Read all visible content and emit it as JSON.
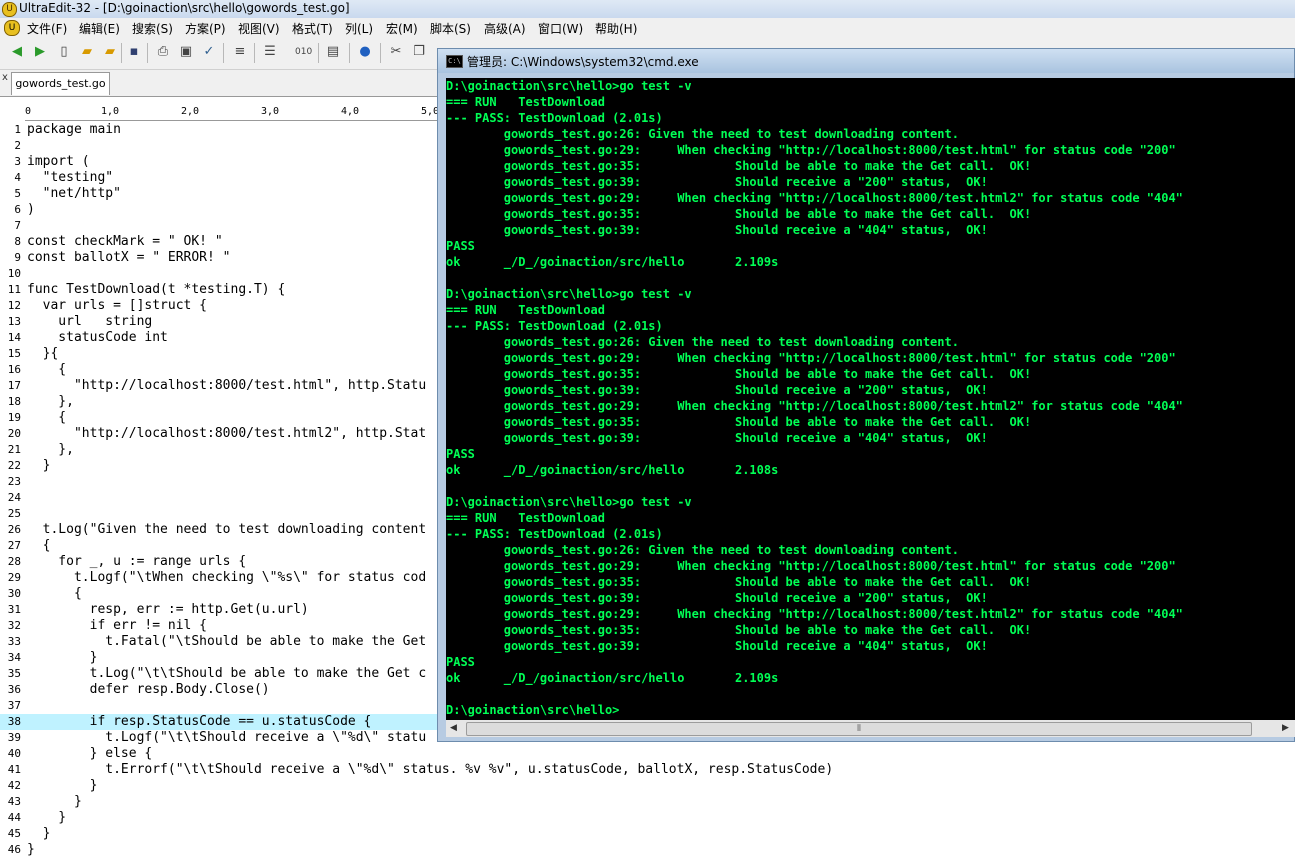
{
  "titlebar": {
    "icon": "ultraedit-icon",
    "title": "UltraEdit-32 - [D:\\goinaction\\src\\hello\\gowords_test.go]"
  },
  "menu": [
    "文件(F)",
    "编辑(E)",
    "搜索(S)",
    "方案(P)",
    "视图(V)",
    "格式(T)",
    "列(L)",
    "宏(M)",
    "脚本(S)",
    "高级(A)",
    "窗口(W)",
    "帮助(H)"
  ],
  "toolbar": {
    "icons": [
      "back-arrow-icon",
      "forward-arrow-icon",
      "new-file-icon",
      "open-folder-icon",
      "open-folder-alt-icon",
      "save-icon",
      "print-icon",
      "print-preview-icon",
      "spellcheck-icon",
      "document-icon",
      "wordwrap-icon",
      "hex-icon",
      "list-icon",
      "browser-icon",
      "cut-icon",
      "copy-icon",
      "paste-icon"
    ]
  },
  "tab": {
    "label": "gowords_test.go"
  },
  "ruler": {
    "labels": [
      "0",
      "1,0",
      "2,0",
      "3,0",
      "4,0",
      "5,0"
    ]
  },
  "editor": {
    "highlight_line": 38,
    "lines": [
      "package main",
      "",
      "import (",
      "  \"testing\"",
      "  \"net/http\"",
      ")",
      "",
      "const checkMark = \" OK! \"",
      "const ballotX = \" ERROR! \"",
      "",
      "func TestDownload(t *testing.T) {",
      "  var urls = []struct {",
      "    url   string",
      "    statusCode int",
      "  }{",
      "    {",
      "      \"http://localhost:8000/test.html\", http.Statu",
      "    },",
      "    {",
      "      \"http://localhost:8000/test.html2\", http.Stat",
      "    },",
      "  }",
      "",
      "",
      "",
      "  t.Log(\"Given the need to test downloading content",
      "  {",
      "    for _, u := range urls {",
      "      t.Logf(\"\\tWhen checking \\\"%s\\\" for status cod",
      "      {",
      "        resp, err := http.Get(u.url)",
      "        if err != nil {",
      "          t.Fatal(\"\\tShould be able to make the Get",
      "        }",
      "        t.Log(\"\\t\\tShould be able to make the Get c",
      "        defer resp.Body.Close()",
      "",
      "        if resp.StatusCode == u.statusCode {",
      "          t.Logf(\"\\t\\tShould receive a \\\"%d\\\" statu",
      "        } else {",
      "          t.Errorf(\"\\t\\tShould receive a \\\"%d\\\" status. %v %v\", u.statusCode, ballotX, resp.StatusCode)",
      "        }",
      "      }",
      "    }",
      "  }",
      "}"
    ]
  },
  "cmd": {
    "icon": "cmd-icon",
    "icon_text": "C:\\",
    "title": "管理员: C:\\Windows\\system32\\cmd.exe",
    "output": [
      "D:\\goinaction\\src\\hello>go test -v",
      "=== RUN   TestDownload",
      "--- PASS: TestDownload (2.01s)",
      "        gowords_test.go:26: Given the need to test downloading content.",
      "        gowords_test.go:29:     When checking \"http://localhost:8000/test.html\" for status code \"200\"",
      "        gowords_test.go:35:             Should be able to make the Get call.  OK!",
      "        gowords_test.go:39:             Should receive a \"200\" status,  OK!",
      "        gowords_test.go:29:     When checking \"http://localhost:8000/test.html2\" for status code \"404\"",
      "        gowords_test.go:35:             Should be able to make the Get call.  OK!",
      "        gowords_test.go:39:             Should receive a \"404\" status,  OK!",
      "PASS",
      "ok      _/D_/goinaction/src/hello       2.109s",
      "",
      "D:\\goinaction\\src\\hello>go test -v",
      "=== RUN   TestDownload",
      "--- PASS: TestDownload (2.01s)",
      "        gowords_test.go:26: Given the need to test downloading content.",
      "        gowords_test.go:29:     When checking \"http://localhost:8000/test.html\" for status code \"200\"",
      "        gowords_test.go:35:             Should be able to make the Get call.  OK!",
      "        gowords_test.go:39:             Should receive a \"200\" status,  OK!",
      "        gowords_test.go:29:     When checking \"http://localhost:8000/test.html2\" for status code \"404\"",
      "        gowords_test.go:35:             Should be able to make the Get call.  OK!",
      "        gowords_test.go:39:             Should receive a \"404\" status,  OK!",
      "PASS",
      "ok      _/D_/goinaction/src/hello       2.108s",
      "",
      "D:\\goinaction\\src\\hello>go test -v",
      "=== RUN   TestDownload",
      "--- PASS: TestDownload (2.01s)",
      "        gowords_test.go:26: Given the need to test downloading content.",
      "        gowords_test.go:29:     When checking \"http://localhost:8000/test.html\" for status code \"200\"",
      "        gowords_test.go:35:             Should be able to make the Get call.  OK!",
      "        gowords_test.go:39:             Should receive a \"200\" status,  OK!",
      "        gowords_test.go:29:     When checking \"http://localhost:8000/test.html2\" for status code \"404\"",
      "        gowords_test.go:35:             Should be able to make the Get call.  OK!",
      "        gowords_test.go:39:             Should receive a \"404\" status,  OK!",
      "PASS",
      "ok      _/D_/goinaction/src/hello       2.109s",
      "",
      "D:\\goinaction\\src\\hello>"
    ]
  }
}
